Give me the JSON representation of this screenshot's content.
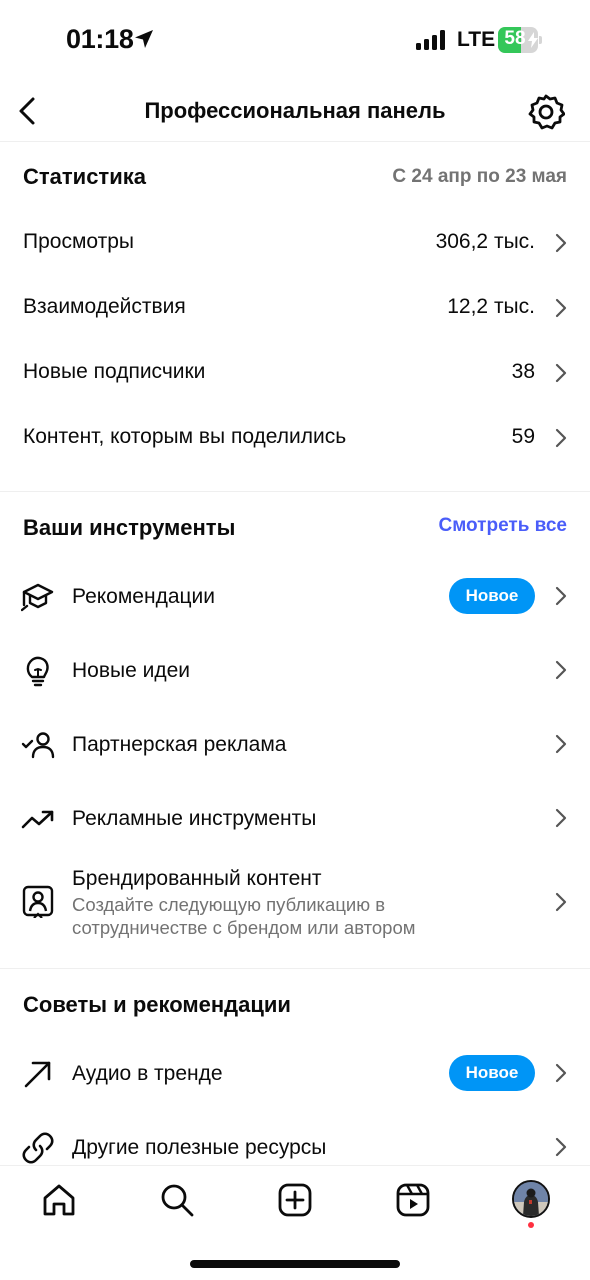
{
  "status_bar": {
    "time": "01:18",
    "network": "LTE",
    "battery": "58",
    "battery_level": 0.58
  },
  "header": {
    "title": "Профессиональная панель"
  },
  "stats": {
    "title": "Статистика",
    "period": "С 24 апр по 23 мая",
    "rows": [
      {
        "label": "Просмотры",
        "value": "306,2 тыс."
      },
      {
        "label": "Взаимодействия",
        "value": "12,2 тыс."
      },
      {
        "label": "Новые подписчики",
        "value": "38"
      },
      {
        "label": "Контент, которым вы поделились",
        "value": "59"
      }
    ]
  },
  "tools": {
    "title": "Ваши инструменты",
    "see_all": "Смотреть все",
    "items": [
      {
        "label": "Рекомендации",
        "badge": "Новое",
        "icon": "graduation-cap-icon"
      },
      {
        "label": "Новые идеи",
        "icon": "lightbulb-icon"
      },
      {
        "label": "Партнерская реклама",
        "icon": "person-check-icon"
      },
      {
        "label": "Рекламные инструменты",
        "icon": "trend-up-icon"
      },
      {
        "label": "Брендированный контент",
        "sub": "Создайте следующую публикацию в сотрудничестве с брендом или автором",
        "icon": "branded-content-icon"
      }
    ]
  },
  "tips": {
    "title": "Советы и рекомендации",
    "items": [
      {
        "label": "Аудио в тренде",
        "badge": "Новое",
        "icon": "arrow-up-right-icon"
      },
      {
        "label": "Другие полезные ресурсы",
        "icon": "link-icon"
      }
    ]
  },
  "nav": [
    "home-icon",
    "search-icon",
    "create-icon",
    "reels-icon",
    "profile-avatar"
  ],
  "colors": {
    "accent_blue": "#0095f6",
    "link_blue": "#4a5df9",
    "battery_green": "#34c759",
    "muted": "#737373"
  }
}
